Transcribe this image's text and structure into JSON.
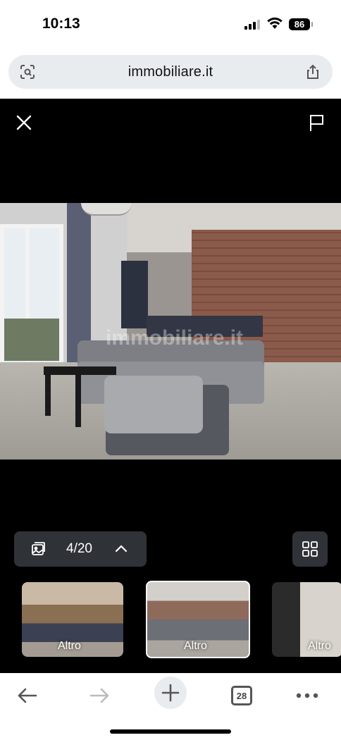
{
  "status_bar": {
    "time": "10:13",
    "battery": "86"
  },
  "browser": {
    "url": "immobiliare.it",
    "tab_count": "28"
  },
  "gallery": {
    "counter": "4/20",
    "photo_watermark": "immobiliare.it",
    "thumbnails": [
      {
        "label": "Altro",
        "active": false
      },
      {
        "label": "Altro",
        "active": true
      },
      {
        "label": "Altro",
        "active": false
      }
    ]
  },
  "colors": {
    "background": "#000000",
    "pill": "#2f3338",
    "toolbar": "#ffffff"
  }
}
